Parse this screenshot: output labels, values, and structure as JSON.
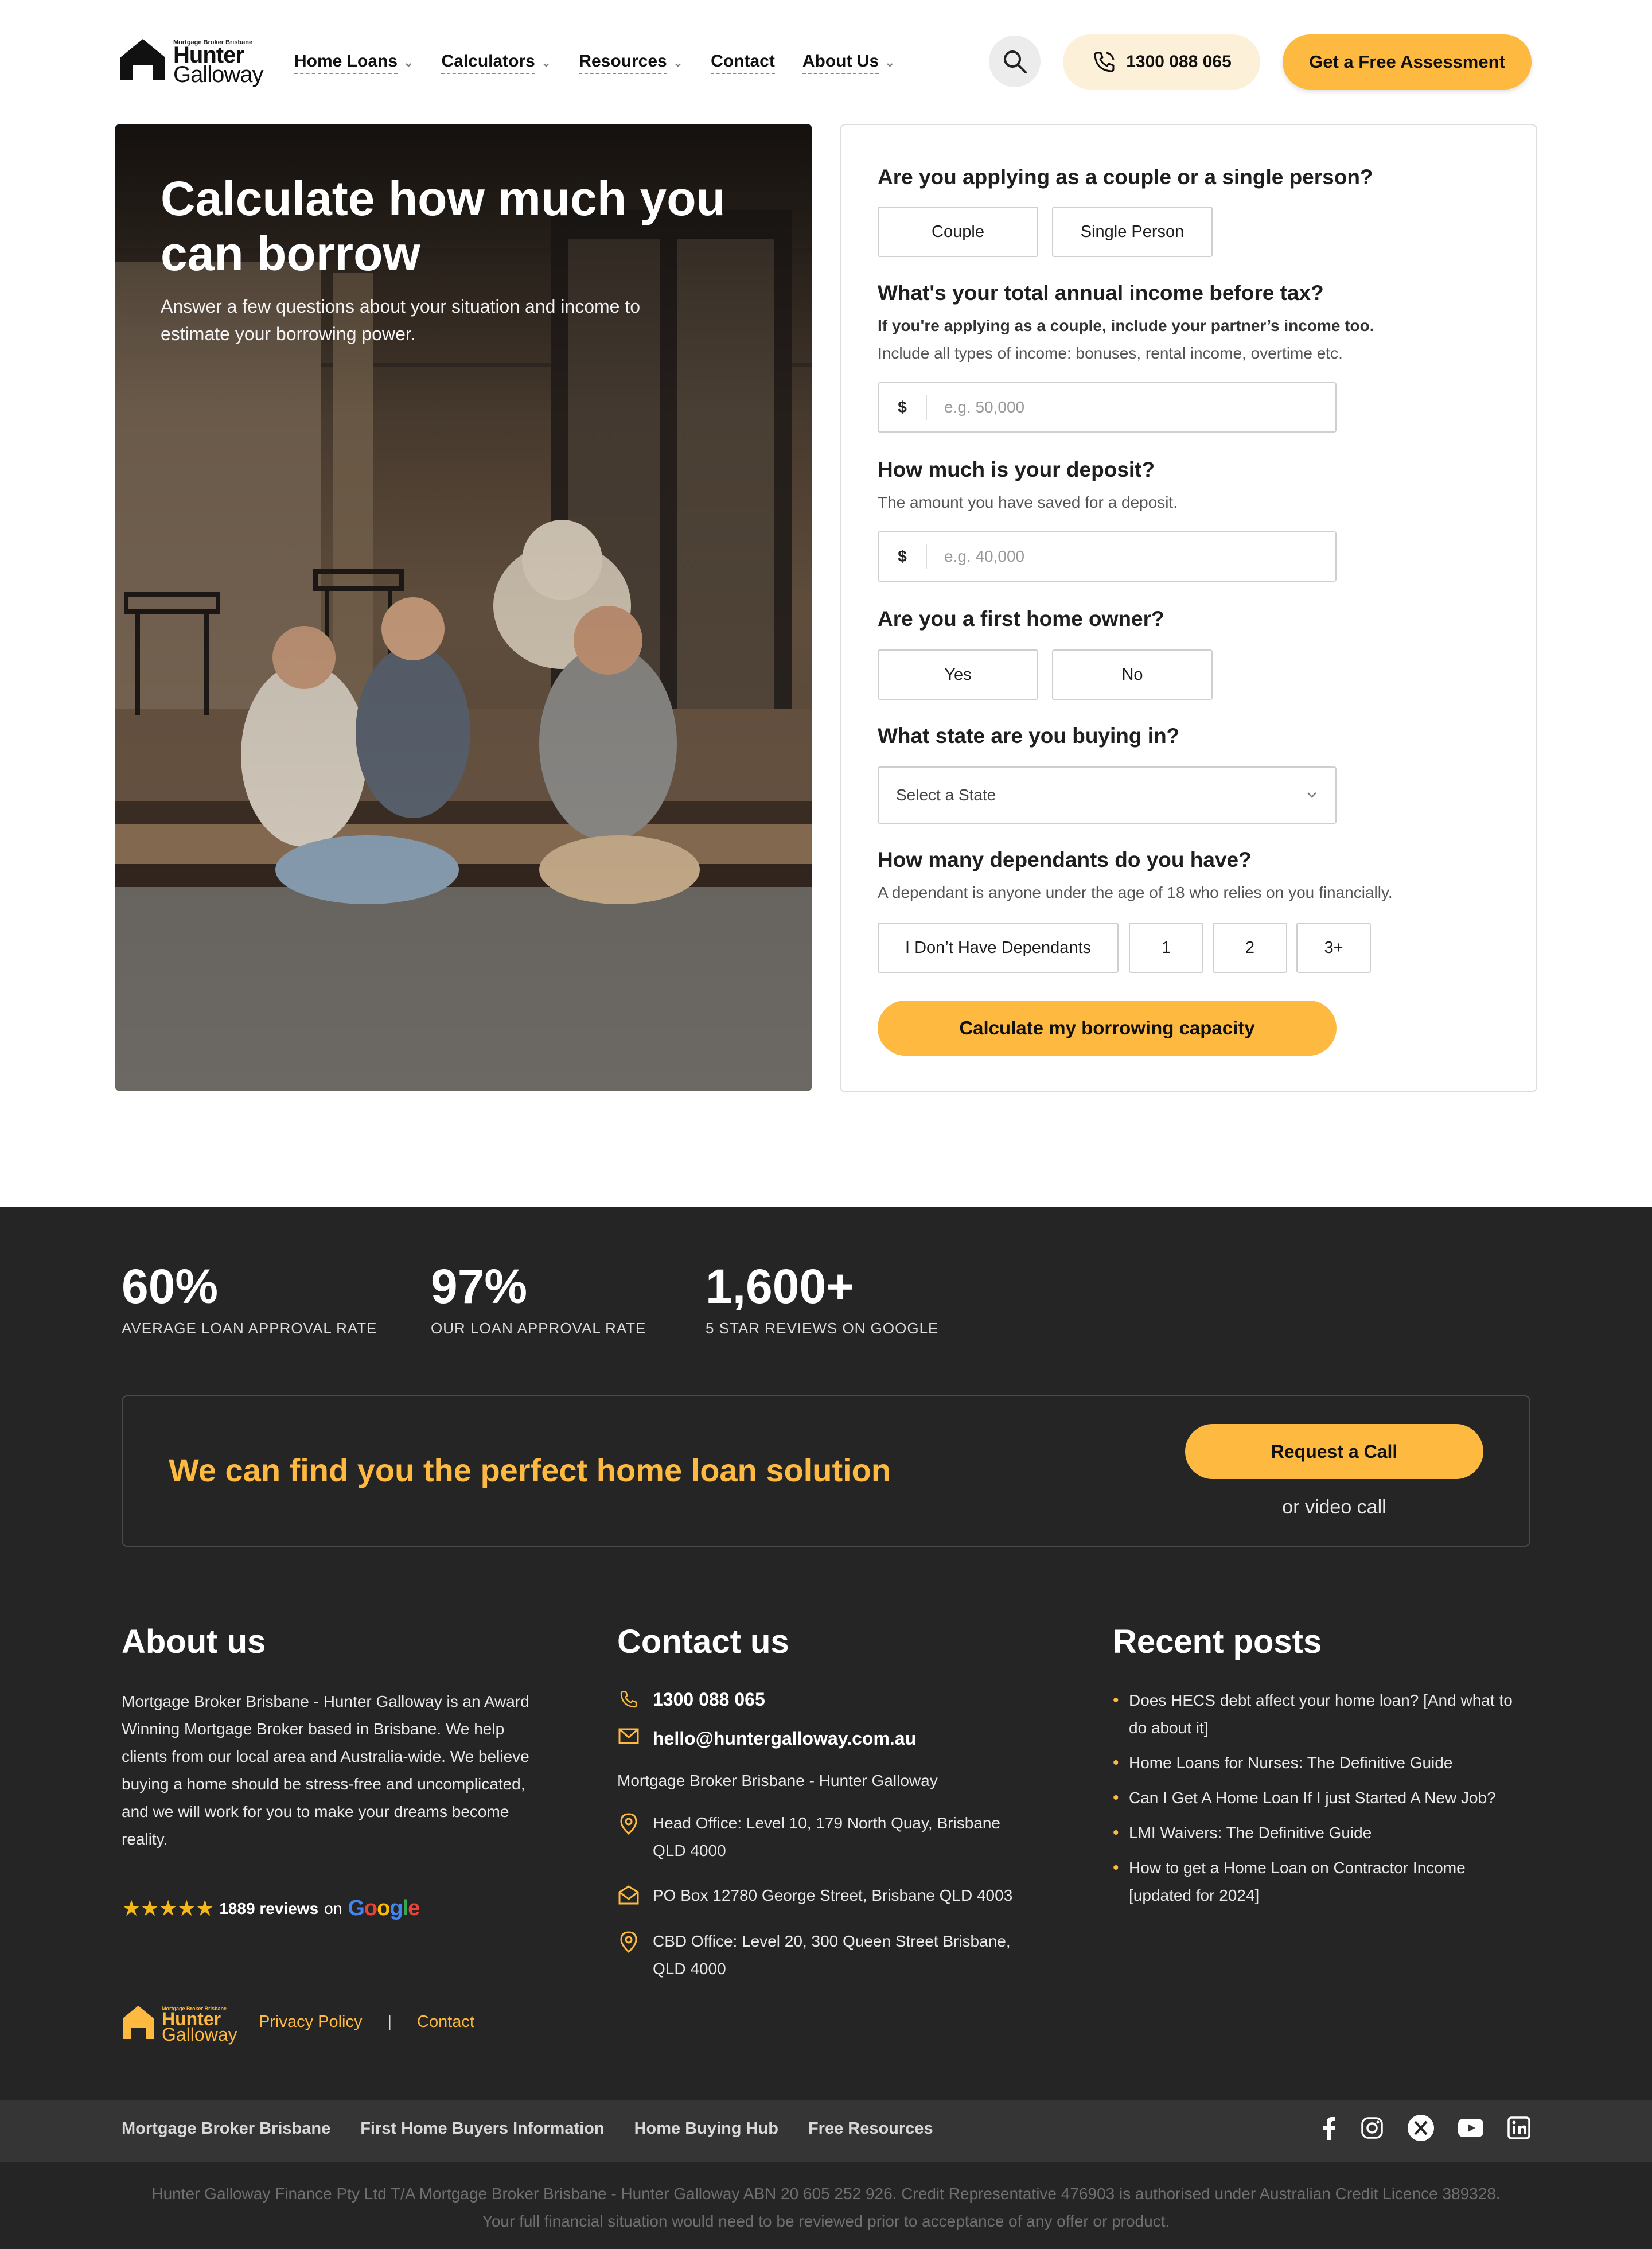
{
  "header": {
    "logo": {
      "tagline": "Mortgage Broker Brisbane",
      "word1": "Hunter",
      "word2": "Galloway"
    },
    "nav": [
      {
        "label": "Home Loans",
        "dropdown": true
      },
      {
        "label": "Calculators",
        "dropdown": true
      },
      {
        "label": "Resources",
        "dropdown": true
      },
      {
        "label": "Contact",
        "dropdown": false
      },
      {
        "label": "About Us",
        "dropdown": true
      }
    ],
    "phone": "1300 088 065",
    "cta": "Get a Free Assessment"
  },
  "hero": {
    "title": "Calculate how much you can borrow",
    "subtitle": "Answer a few questions about your situation and income to estimate your borrowing power."
  },
  "form": {
    "q1": {
      "label": "Are you applying as a couple or a single person?",
      "options": [
        "Couple",
        "Single Person"
      ]
    },
    "q2": {
      "label": "What's your total annual income before tax?",
      "hint_bold": "If you're applying as a couple, include your partner’s income too.",
      "hint": "Include all types of income: bonuses, rental income, overtime etc.",
      "currency": "$",
      "placeholder": "e.g. 50,000"
    },
    "q3": {
      "label": "How much is your deposit?",
      "hint": "The amount you have saved for a deposit.",
      "currency": "$",
      "placeholder": "e.g. 40,000"
    },
    "q4": {
      "label": "Are you a first home owner?",
      "options": [
        "Yes",
        "No"
      ]
    },
    "q5": {
      "label": "What state are you buying in?",
      "select_value": "Select a State"
    },
    "q6": {
      "label": "How many dependants do you have?",
      "hint": "A dependant is anyone under the age of 18 who relies on you financially.",
      "options": [
        "I Don’t Have Dependants",
        "1",
        "2",
        "3+"
      ]
    },
    "submit": "Calculate my borrowing capacity"
  },
  "stats": [
    {
      "value": "60%",
      "caption": "AVERAGE LOAN APPROVAL RATE"
    },
    {
      "value": "97%",
      "caption": "OUR LOAN APPROVAL RATE"
    },
    {
      "value": "1,600+",
      "caption": "5 STAR REVIEWS ON GOOGLE"
    }
  ],
  "banner": {
    "text": "We can find you the perfect home loan solution",
    "button": "Request a Call",
    "secondary": "or video call"
  },
  "about": {
    "heading": "About us",
    "text": "Mortgage Broker Brisbane - Hunter Galloway is an Award Winning Mortgage Broker based in Brisbane. We help clients from our local area and Australia-wide. We believe buying a home should be stress-free and uncomplicated, and we will work for you to make your dreams become reality.",
    "reviews_count": "1889 reviews",
    "reviews_on": "on",
    "google": "Google"
  },
  "contact": {
    "heading": "Contact us",
    "phone": "1300 088 065",
    "email": "hello@huntergalloway.com.au",
    "company": "Mortgage Broker Brisbane - Hunter Galloway",
    "head_office": "Head Office: Level 10, 179 North Quay, Brisbane QLD 4000",
    "po_box": "PO Box 12780 George Street, Brisbane QLD 4003",
    "cbd_office": "CBD Office: Level 20, 300 Queen Street Brisbane, QLD 4000"
  },
  "recent_posts": {
    "heading": "Recent posts",
    "items": [
      "Does HECS debt affect your home loan? [And what to do about it]",
      "Home Loans for Nurses: The Definitive Guide",
      "Can I Get A Home Loan If I just Started A New Job?",
      "LMI Waivers: The Definitive Guide",
      "How to get a Home Loan on Contractor Income [updated for 2024]"
    ]
  },
  "footer_links": {
    "privacy": "Privacy Policy",
    "separator": "|",
    "contact": "Contact"
  },
  "sub_links": [
    "Mortgage Broker Brisbane",
    "First Home Buyers Information",
    "Home Buying Hub",
    "Free Resources"
  ],
  "social_icons": [
    "facebook-icon",
    "instagram-icon",
    "x-icon",
    "youtube-icon",
    "linkedin-icon"
  ],
  "legal": {
    "line1": "Hunter Galloway Finance Pty Ltd T/A Mortgage Broker Brisbane - Hunter Galloway ABN 20 605 252 926. Credit Representative 476903 is authorised under Australian Credit Licence 389328.",
    "line2": "Your full financial situation would need to be reviewed prior to acceptance of any offer or product."
  },
  "colors": {
    "accent": "#fdb940",
    "dark": "#252525",
    "subbar": "#353535"
  }
}
